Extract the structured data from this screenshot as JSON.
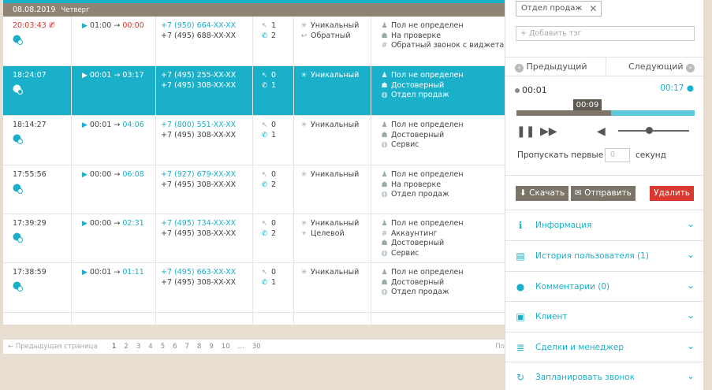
{
  "date_header": {
    "date": "08.08.2019",
    "weekday": "Четверг"
  },
  "calls": [
    {
      "time": "20:03:43",
      "missed": true,
      "wait": "01:00",
      "talk": "00:00",
      "talk_state": "missed",
      "number_from": "+7 (950) 664-XX-XX",
      "number_to": "+7 (495) 688-XX-XX",
      "visits": "1",
      "calls": "2",
      "tags": [
        "Уникальный",
        "Обратный"
      ],
      "tag_icons": [
        "asterisk-icon",
        "return-icon"
      ],
      "info": [
        "Пол не определен",
        "На проверке",
        "Обратный звонок с виджета"
      ],
      "info_icons": [
        "person-icon",
        "robot-icon",
        "hash-icon"
      ]
    },
    {
      "time": "18:24:07",
      "missed": false,
      "selected": true,
      "wait": "00:01",
      "talk": "03:17",
      "talk_state": "normal",
      "number_from": "+7 (495) 255-XX-XX",
      "number_to": "+7 (495) 308-XX-XX",
      "visits": "0",
      "calls": "1",
      "tags": [
        "Уникальный"
      ],
      "tag_icons": [
        "asterisk-icon"
      ],
      "info": [
        "Пол не определен",
        "Достоверный",
        "Отдел продаж"
      ],
      "info_icons": [
        "person-icon",
        "robot-icon",
        "headset-icon"
      ]
    },
    {
      "time": "18:14:27",
      "missed": false,
      "wait": "00:01",
      "talk": "04:06",
      "talk_state": "link",
      "number_from": "+7 (800) 551-XX-XX",
      "number_to": "+7 (495) 308-XX-XX",
      "visits": "0",
      "calls": "1",
      "tags": [
        "Уникальный"
      ],
      "tag_icons": [
        "asterisk-icon"
      ],
      "info": [
        "Пол не определен",
        "Достоверный",
        "Сервис"
      ],
      "info_icons": [
        "person-icon",
        "robot-icon",
        "headset-icon"
      ]
    },
    {
      "time": "17:55:56",
      "missed": false,
      "wait": "00:00",
      "talk": "06:08",
      "talk_state": "link",
      "number_from": "+7 (927) 679-XX-XX",
      "number_to": "+7 (495) 308-XX-XX",
      "visits": "0",
      "calls": "2",
      "tags": [
        "Уникальный"
      ],
      "tag_icons": [
        "asterisk-icon"
      ],
      "info": [
        "Пол не определен",
        "На проверке",
        "Отдел продаж"
      ],
      "info_icons": [
        "person-icon",
        "robot-icon",
        "headset-icon"
      ]
    },
    {
      "time": "17:39:29",
      "missed": false,
      "wait": "00:00",
      "talk": "02:31",
      "talk_state": "link",
      "number_from": "+7 (495) 734-XX-XX",
      "number_to": "+7 (495) 308-XX-XX",
      "visits": "0",
      "calls": "2",
      "tags": [
        "Уникальный",
        "Целевой"
      ],
      "tag_icons": [
        "asterisk-icon",
        "target-icon"
      ],
      "info": [
        "Пол не определен",
        "Аккаунтинг",
        "Достоверный",
        "Сервис"
      ],
      "info_icons": [
        "person-icon",
        "hash-icon",
        "robot-icon",
        "headset-icon"
      ]
    },
    {
      "time": "17:38:59",
      "missed": false,
      "wait": "00:01",
      "talk": "01:11",
      "talk_state": "link",
      "number_from": "+7 (495) 663-XX-XX",
      "number_to": "+7 (495) 308-XX-XX",
      "visits": "0",
      "calls": "1",
      "tags": [
        "Уникальный"
      ],
      "tag_icons": [
        "asterisk-icon"
      ],
      "info": [
        "Пол не определен",
        "Достоверный",
        "Отдел продаж"
      ],
      "info_icons": [
        "person-icon",
        "robot-icon",
        "headset-icon"
      ]
    }
  ],
  "pagination": {
    "prev_label": "← Предыдущая страница",
    "pages": [
      "1",
      "2",
      "3",
      "4",
      "5",
      "6",
      "7",
      "8",
      "9",
      "10",
      "...",
      "30"
    ],
    "current": "1",
    "next_label": "По"
  },
  "panel": {
    "tag_chip": "Отдел продаж",
    "tag_input_placeholder": "+ Добавить тэг",
    "prev_label": "Предыдущий",
    "next_label": "Следующий",
    "time_current": "00:01",
    "time_total": "00:17",
    "hover_time": "00:09",
    "progress_fraction": 0.53,
    "volume_fraction": 0.43,
    "skip_prefix": "Пропускать первые",
    "skip_value": "0",
    "skip_suffix": "секунд",
    "download_label": "Скачать",
    "send_label": "Отправить",
    "delete_label": "Удалить",
    "sections": [
      {
        "label": "Информация",
        "icon": "info-icon"
      },
      {
        "label": "История пользователя (1)",
        "icon": "history-icon"
      },
      {
        "label": "Комментарии (0)",
        "icon": "comment-icon"
      },
      {
        "label": "Клиент",
        "icon": "client-card-icon"
      },
      {
        "label": "Сделки и менеджер",
        "icon": "deals-icon"
      },
      {
        "label": "Запланировать звонок",
        "icon": "schedule-icon"
      }
    ]
  },
  "colors": {
    "accent": "#1ab0c9",
    "missed": "#d9382f",
    "date_bar": "#8f8474",
    "delete": "#d9382f"
  }
}
